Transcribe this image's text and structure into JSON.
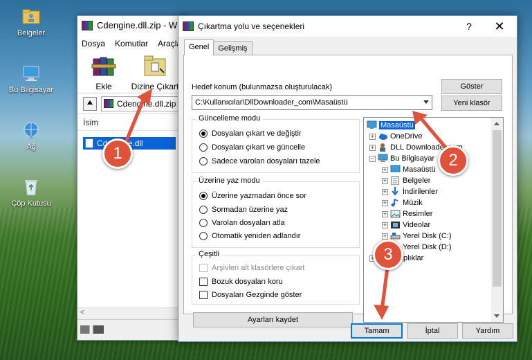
{
  "desktop": {
    "icons": [
      {
        "label": "Belgeler",
        "icon": "folder-user-icon"
      },
      {
        "label": "Bu Bilgisayar",
        "icon": "computer-icon"
      },
      {
        "label": "Ağ",
        "icon": "network-icon"
      },
      {
        "label": "Çöp Kutusu",
        "icon": "recycle-bin-icon"
      }
    ]
  },
  "winrar": {
    "title": "Cdengine.dll.zip - W",
    "menu": [
      "Dosya",
      "Komutlar",
      "Araçla"
    ],
    "toolbar": {
      "add_label": "Ekle",
      "extract_label": "Dizine Çıkart"
    },
    "address": "Cdengine.dll.zip",
    "column_header": "İsim",
    "file_name": "Cdengine.dll"
  },
  "dialog": {
    "title": "Çıkartma yolu ve seçenekleri",
    "help_glyph": "?",
    "close_glyph": "✕",
    "tabs": [
      "Genel",
      "Gelişmiş"
    ],
    "dest_label": "Hedef konum (bulunmazsa oluşturulacak)",
    "dest_value": "C:\\Kullanıcılar\\DllDownloader_com\\Masaüstü",
    "show_button": "Göster",
    "new_folder_button": "Yeni klasör",
    "update_mode": {
      "title": "Güncelleme modu",
      "options": [
        "Dosyaları çıkart ve değiştir",
        "Dosyaları çıkart ve güncelle",
        "Sadece varolan dosyaları tazele"
      ],
      "selected": 0
    },
    "overwrite_mode": {
      "title": "Üzerine yaz modu",
      "options": [
        "Üzerine yazmadan önce sor",
        "Sormadan üzerine yaz",
        "Varolan dosyaları atla",
        "Otomatik yeniden adlandır"
      ],
      "selected": 0
    },
    "misc": {
      "title": "Çeşitli",
      "options": [
        "Arşivleri alt klasörlere çıkart",
        "Bozuk dosyaları koru",
        "Dosyaları Gezginde göster"
      ],
      "disabled": [
        true,
        false,
        false
      ]
    },
    "save_settings_button": "Ayarları kaydet",
    "ok_button": "Tamam",
    "cancel_button": "İptal",
    "help_button": "Yardım",
    "tree": [
      {
        "label": "Masaüstü",
        "icon": "desktop-icon",
        "selected": true
      },
      {
        "label": "OneDrive",
        "icon": "cloud-icon"
      },
      {
        "label": "DLL Downloader.com",
        "icon": "user-icon"
      },
      {
        "label": "Bu Bilgisayar",
        "icon": "computer-icon"
      },
      {
        "label": "Masaüstü",
        "icon": "desktop-icon"
      },
      {
        "label": "Belgeler",
        "icon": "documents-icon"
      },
      {
        "label": "İndirilenler",
        "icon": "download-icon"
      },
      {
        "label": "Müzik",
        "icon": "music-icon"
      },
      {
        "label": "Resimler",
        "icon": "pictures-icon"
      },
      {
        "label": "Videolar",
        "icon": "video-icon"
      },
      {
        "label": "Yerel Disk (C:)",
        "icon": "drive-icon"
      },
      {
        "label": "Yerel Disk (D:)",
        "icon": "drive-icon"
      },
      {
        "label": "Kitaplıklar",
        "icon": "library-icon"
      }
    ]
  },
  "annotations": {
    "step1": "1",
    "step2": "2",
    "step3": "3",
    "arrow_color": "#e0523a"
  }
}
